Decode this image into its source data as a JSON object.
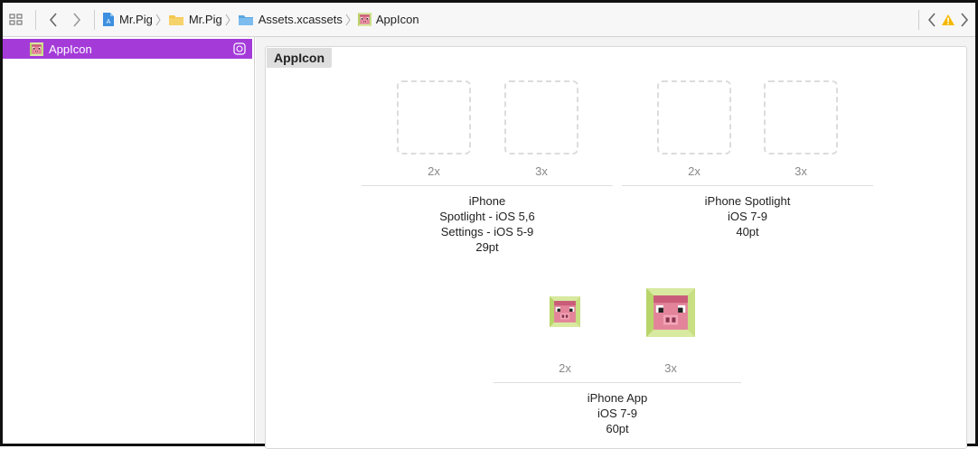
{
  "jumpbar": {
    "breadcrumbs": [
      {
        "label": "Mr.Pig",
        "icon": "xcode-project-icon"
      },
      {
        "label": "Mr.Pig",
        "icon": "folder-icon"
      },
      {
        "label": "Assets.xcassets",
        "icon": "asset-catalog-folder-icon"
      },
      {
        "label": "AppIcon",
        "icon": "app-icon-set-icon"
      }
    ]
  },
  "sidebar": {
    "items": [
      {
        "label": "AppIcon",
        "icon": "app-icon-set-icon",
        "selected": true,
        "accent": "#a43bd9"
      }
    ]
  },
  "main": {
    "title": "AppIcon",
    "groups": [
      {
        "slots": [
          "2x",
          "3x"
        ],
        "caption": [
          "iPhone",
          "Spotlight - iOS 5,6",
          "Settings - iOS 5-9",
          "29pt"
        ]
      },
      {
        "slots": [
          "2x",
          "3x"
        ],
        "caption": [
          "iPhone Spotlight",
          "iOS 7-9",
          "40pt"
        ]
      },
      {
        "slots": [
          "2x",
          "3x"
        ],
        "caption": [
          "iPhone App",
          "iOS 7-9",
          "60pt"
        ]
      }
    ]
  },
  "colors": {
    "accent": "#a43bd9",
    "warning": "#f5b800",
    "folder": "#f3c64e",
    "asset_folder": "#6fb6e8"
  }
}
